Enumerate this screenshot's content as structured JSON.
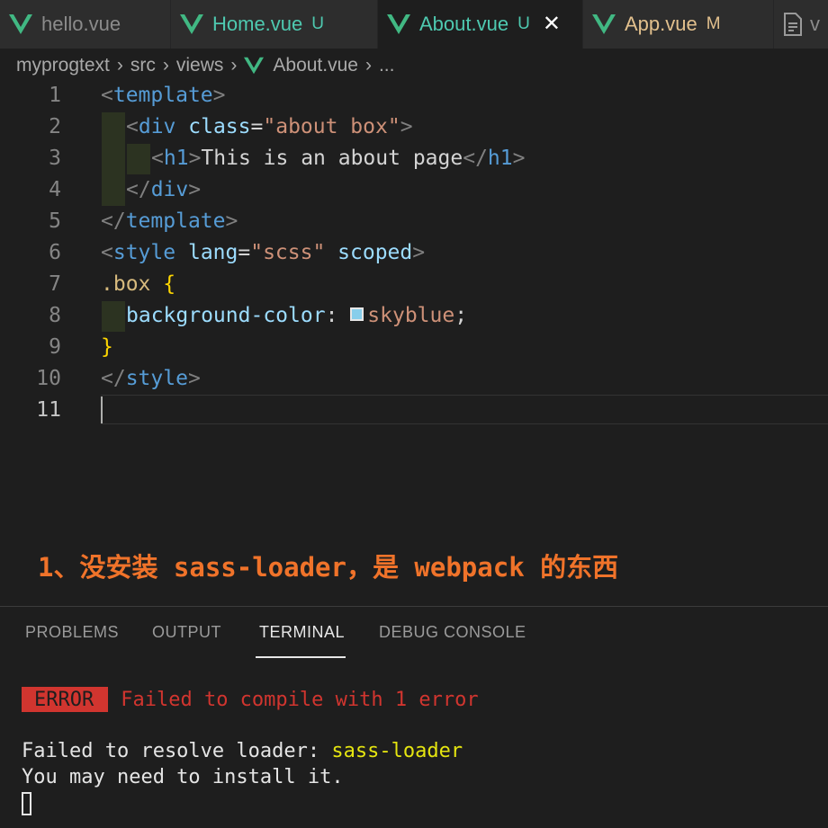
{
  "tabs": [
    {
      "name": "hello.vue",
      "badge": "",
      "state": "normal"
    },
    {
      "name": "Home.vue",
      "badge": "U",
      "state": "untracked"
    },
    {
      "name": "About.vue",
      "badge": "U",
      "state": "active"
    },
    {
      "name": "App.vue",
      "badge": "M",
      "state": "modified"
    },
    {
      "name": "v",
      "badge": "",
      "state": "normal"
    }
  ],
  "close_glyph": "✕",
  "breadcrumb": [
    "myprogtext",
    "src",
    "views",
    "About.vue",
    "..."
  ],
  "breadcrumb_sep": "›",
  "editor": {
    "line_numbers": [
      "1",
      "2",
      "3",
      "4",
      "5",
      "6",
      "7",
      "8",
      "9",
      "10",
      "11"
    ],
    "current_line": "11"
  },
  "code": {
    "l1": {
      "open": "<",
      "tag": "template",
      "close": ">"
    },
    "l2": {
      "open": "<",
      "tag": "div",
      "attr": "class",
      "eq": "=",
      "val": "\"about box\"",
      "close": ">"
    },
    "l3": {
      "open": "<",
      "tag": "h1",
      "close": ">",
      "text": "This is an about page",
      "eopen": "</",
      "etag": "h1",
      "eclose": ">"
    },
    "l4": {
      "open": "</",
      "tag": "div",
      "close": ">"
    },
    "l5": {
      "open": "</",
      "tag": "template",
      "close": ">"
    },
    "l6": {
      "open": "<",
      "tag": "style",
      "attr1": "lang",
      "eq": "=",
      "val": "\"scss\"",
      "attr2": "scoped",
      "close": ">"
    },
    "l7": {
      "sel": ".box",
      "brace": "{"
    },
    "l8": {
      "prop": "background-color",
      "colon": ":",
      "val": "skyblue",
      "semi": ";",
      "swatch_color": "#87ceeb"
    },
    "l9": {
      "brace": "}"
    },
    "l10": {
      "open": "</",
      "tag": "style",
      "close": ">"
    }
  },
  "annotation": "1、没安装 sass-loader，是 webpack 的东西",
  "panel": {
    "tabs": [
      "PROBLEMS",
      "OUTPUT",
      "TERMINAL",
      "DEBUG CONSOLE"
    ],
    "active_tab": "TERMINAL"
  },
  "terminal": {
    "error_badge": "ERROR",
    "error_message": "Failed to compile with 1 error",
    "line1_prefix": "Failed to resolve loader: ",
    "line1_loader": "sass-loader",
    "line2": "You may need to install it."
  },
  "colors": {
    "vue_green": "#4ec9b0",
    "untracked": "#4ec9b0",
    "modified": "#e2c08d",
    "error_red": "#d1352f",
    "annotation_orange": "#f0732a"
  }
}
